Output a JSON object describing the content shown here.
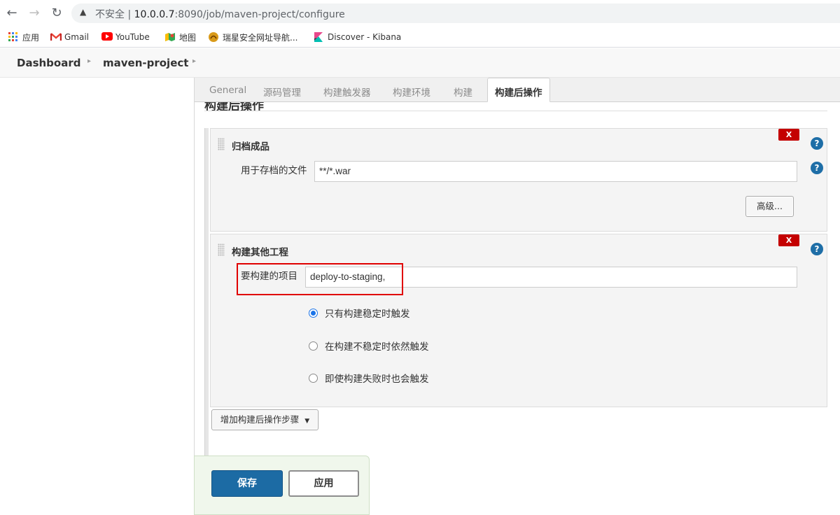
{
  "browser": {
    "back_icon": "arrow-left-icon",
    "forward_icon": "arrow-right-icon",
    "reload_icon": "reload-icon",
    "insecure_label": "不安全",
    "url_host": "10.0.0.7",
    "url_rest": ":8090/job/maven-project/configure",
    "bookmarks": [
      {
        "label": "应用",
        "icon": "apps-grid-icon"
      },
      {
        "label": "Gmail",
        "icon": "gmail-icon"
      },
      {
        "label": "YouTube",
        "icon": "youtube-icon"
      },
      {
        "label": "地图",
        "icon": "maps-icon"
      },
      {
        "label": "瑞星安全网址导航...",
        "icon": "rising-icon"
      },
      {
        "label": "Discover - Kibana",
        "icon": "kibana-icon"
      }
    ]
  },
  "breadcrumb": {
    "items": [
      "Dashboard",
      "maven-project"
    ]
  },
  "tabs": [
    {
      "label": "General"
    },
    {
      "label": "源码管理"
    },
    {
      "label": "构建触发器"
    },
    {
      "label": "构建环境"
    },
    {
      "label": "构建"
    },
    {
      "label": "构建后操作",
      "active": true
    }
  ],
  "section": {
    "title": "构建后操作"
  },
  "archive_block": {
    "title": "归档成品",
    "delete_label": "X",
    "field_label": "用于存档的文件",
    "field_value": "**/*.war",
    "advanced_label": "高级..."
  },
  "build_other_block": {
    "title": "构建其他工程",
    "delete_label": "X",
    "field_label": "要构建的项目",
    "field_value": "deploy-to-staging,",
    "options": [
      {
        "label": "只有构建稳定时触发",
        "selected": true
      },
      {
        "label": "在构建不稳定时依然触发",
        "selected": false
      },
      {
        "label": "即使构建失败时也会触发",
        "selected": false
      }
    ]
  },
  "add_step_label": "增加构建后操作步骤",
  "help_glyph": "?",
  "footer": {
    "save_label": "保存",
    "apply_label": "应用"
  }
}
